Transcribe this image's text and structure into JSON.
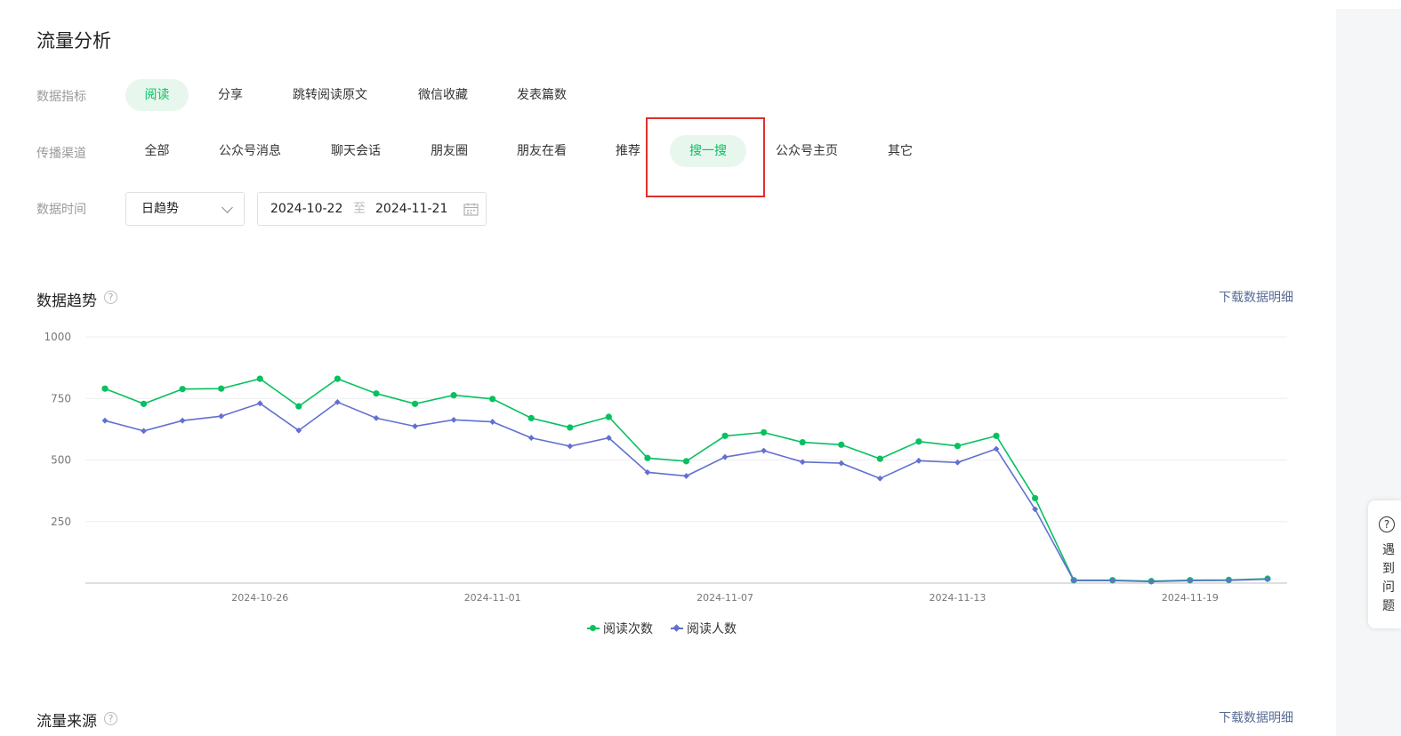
{
  "page": {
    "title": "流量分析"
  },
  "filters": {
    "metric": {
      "label": "数据指标",
      "options": [
        "阅读",
        "分享",
        "跳转阅读原文",
        "微信收藏",
        "发表篇数"
      ],
      "active": 0
    },
    "channel": {
      "label": "传播渠道",
      "options": [
        "全部",
        "公众号消息",
        "聊天会话",
        "朋友圈",
        "朋友在看",
        "推荐",
        "搜一搜",
        "公众号主页",
        "其它"
      ],
      "active": 6
    },
    "time": {
      "label": "数据时间",
      "granularity": "日趋势",
      "start": "2024-10-22",
      "separator": "至",
      "end": "2024-11-21"
    }
  },
  "trend": {
    "title": "数据趋势",
    "info": "?",
    "download": "下载数据明细"
  },
  "source": {
    "title": "流量来源",
    "info": "?",
    "download": "下载数据明细"
  },
  "help": {
    "glyph": "?",
    "text": "遇到问题"
  },
  "colors": {
    "accent": "#07c160",
    "series2": "#6270d1",
    "highlight": "#e0302a",
    "link": "#576b95"
  },
  "chart_data": {
    "type": "line",
    "x": [
      "2024-10-22",
      "2024-10-23",
      "2024-10-24",
      "2024-10-25",
      "2024-10-26",
      "2024-10-27",
      "2024-10-28",
      "2024-10-29",
      "2024-10-30",
      "2024-10-31",
      "2024-11-01",
      "2024-11-02",
      "2024-11-03",
      "2024-11-04",
      "2024-11-05",
      "2024-11-06",
      "2024-11-07",
      "2024-11-08",
      "2024-11-09",
      "2024-11-10",
      "2024-11-11",
      "2024-11-12",
      "2024-11-13",
      "2024-11-14",
      "2024-11-15",
      "2024-11-16",
      "2024-11-17",
      "2024-11-18",
      "2024-11-19",
      "2024-11-20",
      "2024-11-21"
    ],
    "xticks": [
      "2024-10-26",
      "2024-11-01",
      "2024-11-07",
      "2024-11-13",
      "2024-11-19"
    ],
    "yticks": [
      250,
      500,
      750,
      1000
    ],
    "ylim": [
      0,
      1000
    ],
    "grid": true,
    "legend": "bottom",
    "series": [
      {
        "name": "阅读次数",
        "color": "#07c160",
        "marker": "circle",
        "values": [
          790,
          728,
          788,
          790,
          830,
          718,
          830,
          770,
          728,
          763,
          748,
          670,
          632,
          675,
          508,
          495,
          598,
          612,
          572,
          562,
          505,
          575,
          557,
          598,
          345,
          12,
          12,
          8,
          12,
          13,
          18
        ]
      },
      {
        "name": "阅读人数",
        "color": "#6270d1",
        "marker": "diamond",
        "values": [
          660,
          618,
          660,
          678,
          730,
          620,
          735,
          670,
          637,
          663,
          655,
          590,
          556,
          590,
          450,
          435,
          512,
          538,
          492,
          487,
          425,
          497,
          490,
          545,
          300,
          10,
          10,
          6,
          10,
          11,
          16
        ]
      }
    ]
  }
}
